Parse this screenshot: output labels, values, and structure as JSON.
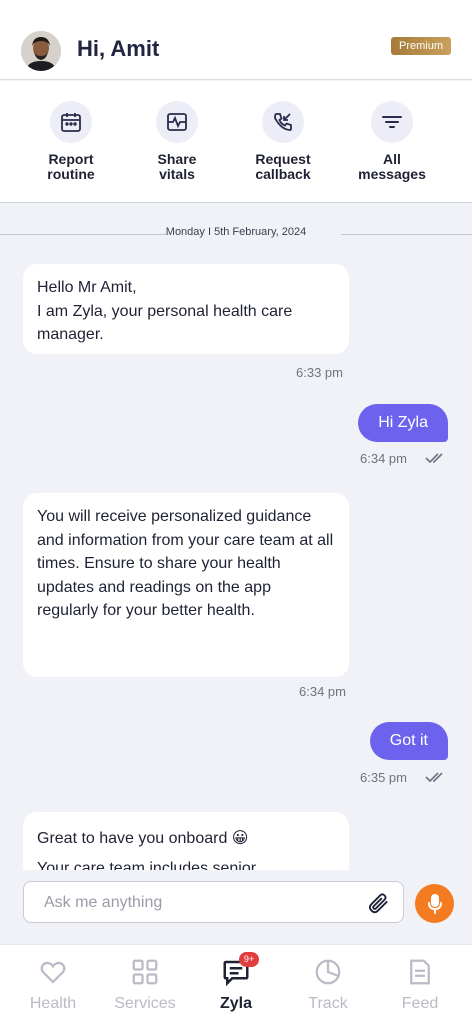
{
  "header": {
    "greeting": "Hi, Amit",
    "badge": "Premium",
    "avatar_icon": "user-avatar"
  },
  "quick_actions": [
    {
      "label": "Report\nroutine",
      "icon": "calendar-icon"
    },
    {
      "label": "Share\nvitals",
      "icon": "vitals-pulse-icon"
    },
    {
      "label": "Request\ncallback",
      "icon": "phone-callback-icon"
    },
    {
      "label": "All\nmessages",
      "icon": "filter-icon"
    }
  ],
  "chat": {
    "date": "Monday I 5th February, 2024",
    "messages": [
      {
        "from": "care",
        "text": "Hello Mr Amit,\nI am Zyla, your personal health care manager.",
        "time": "6:33 pm"
      },
      {
        "from": "user",
        "text": "Hi Zyla",
        "time": "6:34 pm"
      },
      {
        "from": "care",
        "text": "You will receive personalized guidance and information from your care team at all times. Ensure to share your health updates and readings on the app regularly for your better health.",
        "time": "6:34 pm"
      },
      {
        "from": "user",
        "text": "Got it",
        "time": "6:35 pm"
      },
      {
        "from": "care",
        "text": "Great to have you onboard 😀\nYour care team includes senior",
        "time": ""
      }
    ]
  },
  "composer": {
    "placeholder": "Ask me anything",
    "value": ""
  },
  "nav": {
    "items": [
      {
        "label": "Health",
        "icon": "heart-icon"
      },
      {
        "label": "Services",
        "icon": "grid-icon"
      },
      {
        "label": "Zyla",
        "icon": "chat-icon",
        "badge": "9+"
      },
      {
        "label": "Track",
        "icon": "pie-chart-icon"
      },
      {
        "label": "Feed",
        "icon": "document-icon"
      }
    ],
    "active": "Zyla"
  },
  "colors": {
    "accent": "#6c62ee",
    "mic": "#f47b22",
    "badge": "#e23d3d",
    "premium": "#b48a48"
  }
}
